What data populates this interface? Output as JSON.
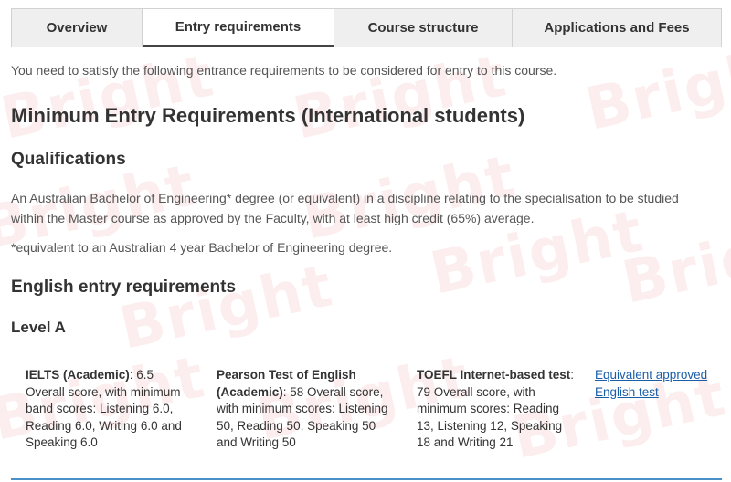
{
  "tabs": [
    {
      "label": "Overview",
      "active": false
    },
    {
      "label": "Entry requirements",
      "active": true
    },
    {
      "label": "Course structure",
      "active": false
    },
    {
      "label": "Applications and Fees",
      "active": false
    }
  ],
  "intro": "You need to satisfy the following entrance requirements to be considered for entry to this course.",
  "heading_main": "Minimum Entry Requirements (International students)",
  "qualifications": {
    "heading": "Qualifications",
    "text": "An Australian Bachelor of Engineering* degree (or equivalent) in a discipline relating to the specialisation to be studied within the Master course as approved by the Faculty, with at least high credit (65%) average.",
    "note": "*equivalent to an Australian 4 year Bachelor of Engineering degree."
  },
  "english": {
    "heading": "English entry requirements",
    "level": "Level A",
    "tests": [
      {
        "name": "IELTS (Academic)",
        "detail": ": 6.5 Overall score, with minimum band scores: Listening 6.0, Reading 6.0, Writing 6.0 and Speaking 6.0"
      },
      {
        "name": "Pearson Test of English (Academic)",
        "detail": ": 58 Overall score, with minimum scores: Listening 50, Reading 50, Speaking 50 and Writing 50"
      },
      {
        "name": "TOEFL Internet-based test",
        "detail": ": 79 Overall score, with minimum scores: Reading 13, Listening 12, Speaking 18 and Writing 21"
      }
    ],
    "equivalent_link": "Equivalent approved English test"
  },
  "watermark": "Bright",
  "colors": {
    "link": "#1a5ea8",
    "tab_bg": "#efefef",
    "watermark": "#e87878",
    "accent_line": "#4a90c8"
  }
}
